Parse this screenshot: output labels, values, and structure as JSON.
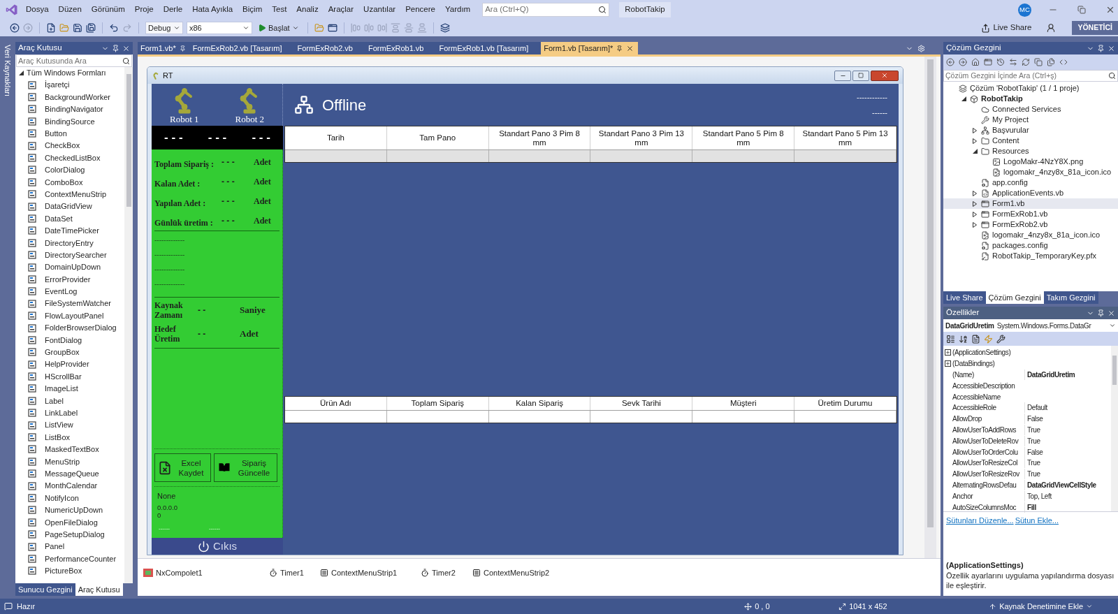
{
  "menu_bar": {
    "items": [
      "Dosya",
      "Düzen",
      "Görünüm",
      "Proje",
      "Derle",
      "Hata Ayıkla",
      "Biçim",
      "Test",
      "Analiz",
      "Araçlar",
      "Uzantılar",
      "Pencere",
      "Yardım"
    ],
    "search": {
      "placeholder": "Ara (Ctrl+Q)"
    },
    "solution_name": "RobotTakip",
    "avatar": "MC"
  },
  "toolbar": {
    "configuration": "Debug",
    "platform": "x86",
    "start": "Başlat",
    "live_share": "Live Share",
    "admin": "YÖNETİCİ"
  },
  "side_tab": "Veri Kaynakları",
  "toolbox": {
    "title": "Araç Kutusu",
    "search": {
      "placeholder": "Araç Kutusunda Ara"
    },
    "group": {
      "label": "Tüm Windows Formları",
      "expanded": true
    },
    "items": [
      "İşaretçi",
      "BackgroundWorker",
      "BindingNavigator",
      "BindingSource",
      "Button",
      "CheckBox",
      "CheckedListBox",
      "ColorDialog",
      "ComboBox",
      "ContextMenuStrip",
      "DataGridView",
      "DataSet",
      "DateTimePicker",
      "DirectoryEntry",
      "DirectorySearcher",
      "DomainUpDown",
      "ErrorProvider",
      "EventLog",
      "FileSystemWatcher",
      "FlowLayoutPanel",
      "FolderBrowserDialog",
      "FontDialog",
      "GroupBox",
      "HelpProvider",
      "HScrollBar",
      "ImageList",
      "Label",
      "LinkLabel",
      "ListView",
      "ListBox",
      "MaskedTextBox",
      "MenuStrip",
      "MessageQueue",
      "MonthCalendar",
      "NotifyIcon",
      "NumericUpDown",
      "OpenFileDialog",
      "PageSetupDialog",
      "Panel",
      "PerformanceCounter",
      "PictureBox"
    ],
    "tabs": [
      {
        "label": "Sunucu Gezgini",
        "selected": false
      },
      {
        "label": "Araç Kutusu",
        "selected": true
      }
    ]
  },
  "document_tabs": [
    {
      "label": "Form1.vb*",
      "selected": false,
      "pinned": true
    },
    {
      "label": "FormExRob2.vb [Tasarım]",
      "selected": false,
      "pinned": false
    },
    {
      "label": "FormExRob2.vb",
      "selected": false,
      "pinned": false
    },
    {
      "label": "FormExRob1.vb",
      "selected": false,
      "pinned": false
    },
    {
      "label": "FormExRob1.vb [Tasarım]",
      "selected": false,
      "pinned": false
    },
    {
      "label": "Form1.vb [Tasarım]*",
      "selected": true,
      "pinned": true
    }
  ],
  "form": {
    "title": "RT",
    "robots": [
      "Robot 1",
      "Robot 2"
    ],
    "connection_status": "Offline",
    "header_values": [
      "------------",
      "------"
    ],
    "counters": [
      "- - -",
      "- - -",
      "- - -"
    ],
    "stats": [
      {
        "label": "Toplam Sipariş :",
        "value": "- - -",
        "unit": "Adet"
      },
      {
        "label": "Kalan Adet :",
        "value": "- - -",
        "unit": "Adet"
      },
      {
        "label": "Yapılan Adet :",
        "value": "- - -",
        "unit": "Adet"
      },
      {
        "label": "Günlük üretim :",
        "value": "- - -",
        "unit": "Adet"
      }
    ],
    "info_lines": [
      "-------------",
      "-------------",
      "-------------",
      "-------------"
    ],
    "targets": [
      {
        "label": "Kaynak Zamanı",
        "value": "- -",
        "unit": "Saniye"
      },
      {
        "label": "Hedef Üretim",
        "value": "- -",
        "unit": "Adet"
      }
    ],
    "buttons": [
      {
        "kind": "excel",
        "label": "Excel Kaydet"
      },
      {
        "kind": "book",
        "label": "Sipariş Güncelle"
      }
    ],
    "device": {
      "mode": "None",
      "address": "0.0.0.0",
      "port": "0",
      "fields": [
        "------",
        "------"
      ]
    },
    "exit_button": "Cıkıs",
    "production_grid": {
      "columns": [
        "Tarih",
        "Tam Pano",
        "Standart Pano 3 Pim 8 mm",
        "Standart Pano 3 Pim 13 mm",
        "Standart Pano 5 Pim 8 mm",
        "Standart Pano 5 Pim 13 mm"
      ]
    },
    "orders_grid": {
      "columns": [
        "Ürün Adı",
        "Toplam Sipariş",
        "Kalan Sipariş",
        "Sevk Tarihi",
        "Müşteri",
        "Üretim Durumu"
      ]
    }
  },
  "component_tray": [
    {
      "kind": "nx",
      "label": "NxCompolet1"
    },
    {
      "kind": "timer",
      "label": "Timer1"
    },
    {
      "kind": "menu",
      "label": "ContextMenuStrip1"
    },
    {
      "kind": "timer",
      "label": "Timer2"
    },
    {
      "kind": "menu",
      "label": "ContextMenuStrip2"
    }
  ],
  "solution_explorer": {
    "title": "Çözüm Gezgini",
    "search": {
      "placeholder": "Çözüm Gezgini İçinde Ara (Ctrl+ş)"
    },
    "tree": [
      {
        "label": "Çözüm 'RobotTakip' (1 / 1 proje)",
        "kind": "solution",
        "selected": false,
        "children": [
          {
            "label": "RobotTakip",
            "kind": "project",
            "expanded": true,
            "selected": false,
            "children": [
              {
                "label": "Connected Services",
                "kind": "cloud",
                "selected": false
              },
              {
                "label": "My Project",
                "kind": "wrench",
                "selected": false
              },
              {
                "label": "Başvurular",
                "kind": "references",
                "expanded": false,
                "selected": false
              },
              {
                "label": "Content",
                "kind": "folder",
                "expanded": false,
                "selected": false
              },
              {
                "label": "Resources",
                "kind": "folder",
                "expanded": true,
                "selected": false,
                "children": [
                  {
                    "label": "LogoMakr-4NzY8X.png",
                    "kind": "image",
                    "selected": false
                  },
                  {
                    "label": "logomakr_4nzy8x_81a_icon.ico",
                    "kind": "ico",
                    "selected": false
                  }
                ]
              },
              {
                "label": "app.config",
                "kind": "config",
                "selected": false
              },
              {
                "label": "ApplicationEvents.vb",
                "kind": "vb",
                "expanded": false,
                "selected": false
              },
              {
                "label": "Form1.vb",
                "kind": "form",
                "expanded": false,
                "selected": true
              },
              {
                "label": "FormExRob1.vb",
                "kind": "form",
                "expanded": false,
                "selected": false
              },
              {
                "label": "FormExRob2.vb",
                "kind": "form",
                "expanded": false,
                "selected": false
              },
              {
                "label": "logomakr_4nzy8x_81a_icon.ico",
                "kind": "ico",
                "selected": false
              },
              {
                "label": "packages.config",
                "kind": "config",
                "selected": false
              },
              {
                "label": "RobotTakip_TemporaryKey.pfx",
                "kind": "key",
                "selected": false
              }
            ]
          }
        ]
      }
    ],
    "tabs": [
      {
        "label": "Live Share",
        "selected": false
      },
      {
        "label": "Çözüm Gezgini",
        "selected": true
      },
      {
        "label": "Takım Gezgini",
        "selected": false
      }
    ]
  },
  "properties": {
    "title": "Özellikler",
    "object_name": "DataGridUretim",
    "object_type": "System.Windows.Forms.DataGr",
    "rows": [
      {
        "kind": "group",
        "name": "(ApplicationSettings)"
      },
      {
        "kind": "group",
        "name": "(DataBindings)"
      },
      {
        "kind": "property",
        "name": "(Name)",
        "value": "DataGridUretim",
        "bold": true
      },
      {
        "kind": "property",
        "name": "AccessibleDescription"
      },
      {
        "kind": "property",
        "name": "AccessibleName"
      },
      {
        "kind": "property",
        "name": "AccessibleRole",
        "value": "Default",
        "bold": false
      },
      {
        "kind": "property",
        "name": "AllowDrop",
        "value": "False",
        "bold": false
      },
      {
        "kind": "property",
        "name": "AllowUserToAddRows",
        "value": "True",
        "bold": false
      },
      {
        "kind": "property",
        "name": "AllowUserToDeleteRov",
        "value": "True",
        "bold": false
      },
      {
        "kind": "property",
        "name": "AllowUserToOrderColu",
        "value": "False",
        "bold": false
      },
      {
        "kind": "property",
        "name": "AllowUserToResizeCol",
        "value": "True",
        "bold": false
      },
      {
        "kind": "property",
        "name": "AllowUserToResizeRov",
        "value": "True",
        "bold": false
      },
      {
        "kind": "property",
        "name": "AlternatingRowsDefau",
        "value": "DataGridViewCellStyle",
        "bold": true
      },
      {
        "kind": "property",
        "name": "Anchor",
        "value": "Top, Left",
        "bold": false
      },
      {
        "kind": "property",
        "name": "AutoSizeColumnsMoc",
        "value": "Fill",
        "bold": true
      }
    ],
    "links": [
      "Sütunları Düzenle...",
      "Sütun Ekle..."
    ],
    "description_title": "(ApplicationSettings)",
    "description": "Özellik ayarlarını uygulama yapılandırma dosyası ile eşleştirir."
  },
  "status_bar": {
    "text": "Hazır",
    "position": "0 , 0",
    "size": "1041 x 452",
    "source_control": "Kaynak Denetimine Ekle"
  }
}
